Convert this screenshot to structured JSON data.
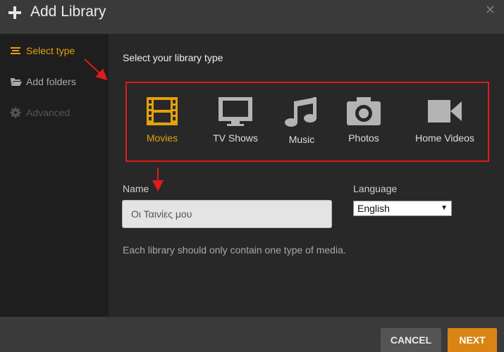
{
  "header": {
    "title": "Add Library",
    "plus_icon": "plus-icon",
    "close_icon": "close-icon"
  },
  "sidebar": {
    "items": [
      {
        "label": "Select type",
        "icon": "lines-icon",
        "state": "active"
      },
      {
        "label": "Add folders",
        "icon": "folder-icon",
        "state": "enabled"
      },
      {
        "label": "Advanced",
        "icon": "gear-icon",
        "state": "disabled"
      }
    ]
  },
  "main": {
    "title": "Select your library type",
    "types": [
      {
        "label": "Movies",
        "icon": "film-icon",
        "selected": true
      },
      {
        "label": "TV Shows",
        "icon": "tv-icon",
        "selected": false
      },
      {
        "label": "Music",
        "icon": "music-note-icon",
        "selected": false
      },
      {
        "label": "Photos",
        "icon": "camera-icon",
        "selected": false
      },
      {
        "label": "Home Videos",
        "icon": "video-camera-icon",
        "selected": false
      }
    ],
    "name_label": "Name",
    "name_value": "Οι Ταινίες μου",
    "language_label": "Language",
    "language_value": "English",
    "hint": "Each library should only contain one type of media."
  },
  "footer": {
    "cancel_label": "CANCEL",
    "next_label": "NEXT"
  },
  "colors": {
    "accent": "#e5a00d",
    "next_button": "#d98516",
    "annotation": "#e01b1b",
    "background": "#282828"
  }
}
